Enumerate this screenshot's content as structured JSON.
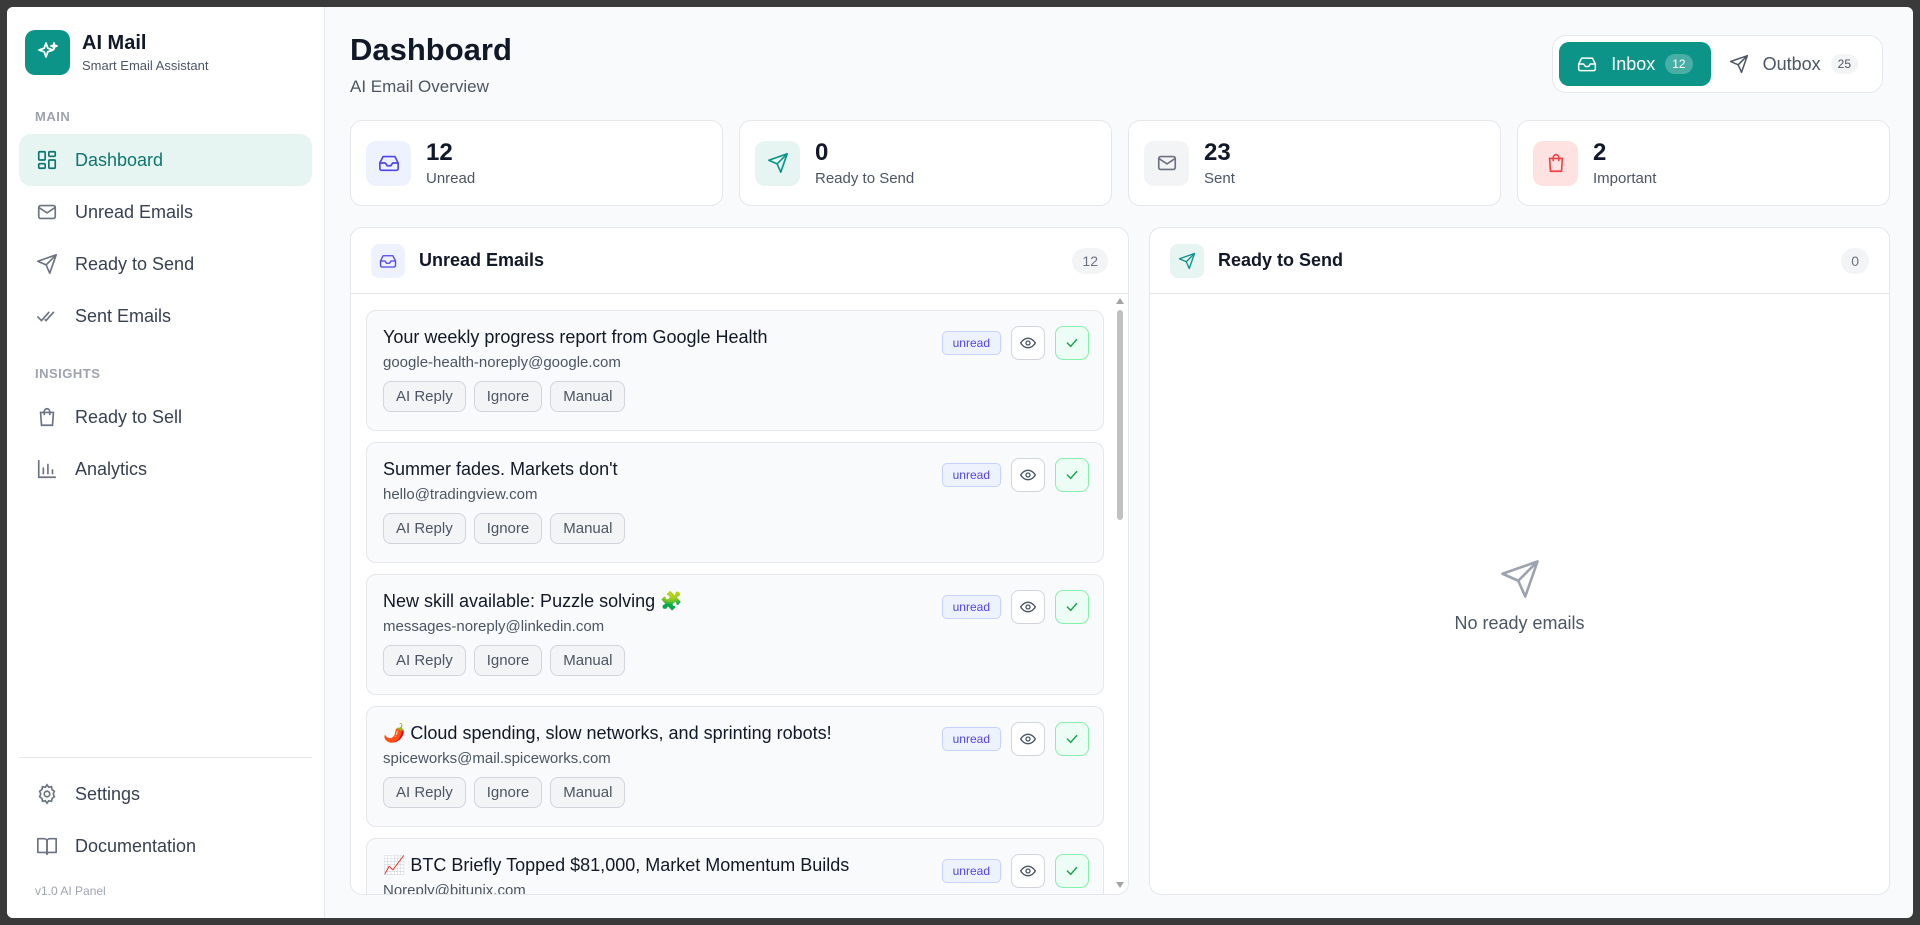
{
  "brand": {
    "name": "AI Mail",
    "subtitle": "Smart Email Assistant"
  },
  "sidebar": {
    "main_label": "MAIN",
    "insights_label": "INSIGHTS",
    "main_items": [
      {
        "label": "Dashboard",
        "icon": "dashboard-icon",
        "active": true
      },
      {
        "label": "Unread Emails",
        "icon": "mail-icon"
      },
      {
        "label": "Ready to Send",
        "icon": "send-icon"
      },
      {
        "label": "Sent Emails",
        "icon": "double-check-icon"
      }
    ],
    "insights_items": [
      {
        "label": "Ready to Sell",
        "icon": "shopping-bag-icon"
      },
      {
        "label": "Analytics",
        "icon": "bar-chart-icon"
      }
    ],
    "bottom_items": [
      {
        "label": "Settings",
        "icon": "gear-icon"
      },
      {
        "label": "Documentation",
        "icon": "book-icon"
      }
    ],
    "version": "v1.0 AI Panel"
  },
  "header": {
    "title": "Dashboard",
    "subtitle": "AI Email Overview"
  },
  "mailbox": {
    "inbox": {
      "label": "Inbox",
      "count": "12"
    },
    "outbox": {
      "label": "Outbox",
      "count": "25"
    }
  },
  "stats": [
    {
      "value": "12",
      "label": "Unread",
      "icon": "inbox-icon",
      "color": "#4f46e5",
      "bg": "#eef2ff"
    },
    {
      "value": "0",
      "label": "Ready to Send",
      "icon": "send-icon",
      "color": "#0d9488",
      "bg": "#e6f4f2"
    },
    {
      "value": "23",
      "label": "Sent",
      "icon": "mail-icon",
      "color": "#6b7280",
      "bg": "#f3f4f6"
    },
    {
      "value": "2",
      "label": "Important",
      "icon": "shopping-bag-icon",
      "color": "#ef4444",
      "bg": "#fee2e2"
    }
  ],
  "unread_panel": {
    "title": "Unread Emails",
    "count": "12",
    "emails": [
      {
        "subject": "Your weekly progress report from Google Health",
        "from": "google-health-noreply@google.com",
        "tag": "unread"
      },
      {
        "subject": "Summer fades. Markets don't",
        "from": "hello@tradingview.com",
        "tag": "unread"
      },
      {
        "subject": "New skill available: Puzzle solving 🧩",
        "from": "messages-noreply@linkedin.com",
        "tag": "unread"
      },
      {
        "subject": "🌶️ Cloud spending, slow networks, and sprinting robots!",
        "from": "spiceworks@mail.spiceworks.com",
        "tag": "unread"
      },
      {
        "subject": "📈 BTC Briefly Topped $81,000, Market Momentum Builds",
        "from": "Noreply@bitunix.com",
        "tag": "unread"
      }
    ],
    "actions": [
      "AI Reply",
      "Ignore",
      "Manual"
    ]
  },
  "ready_panel": {
    "title": "Ready to Send",
    "count": "0",
    "empty_text": "No ready emails"
  }
}
